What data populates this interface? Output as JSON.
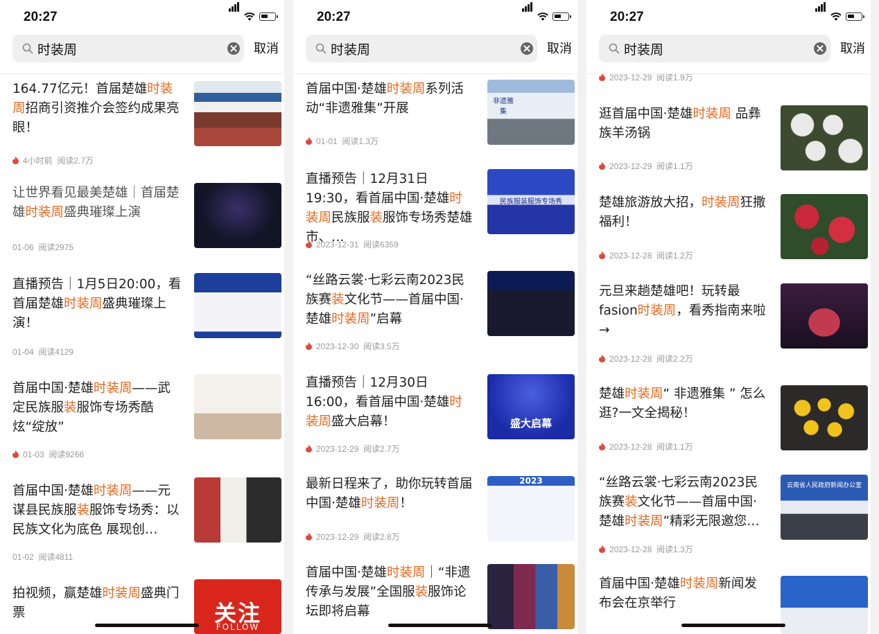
{
  "screens": [
    {
      "status": {
        "time": "20:27"
      },
      "search": {
        "value": "时装周",
        "cancel": "取消"
      },
      "items": [
        {
          "title_parts": [
            {
              "t": "164.77亿元！首届楚雄"
            },
            {
              "t": "时装周",
              "hl": true
            },
            {
              "t": "招商引资推介会签约成果亮眼！"
            }
          ],
          "meta": "4小时前  阅读2.7万",
          "hot": true,
          "thumb": "conference-photo"
        },
        {
          "title_parts": [
            {
              "t": "让世界看见最美楚雄｜首届楚雄"
            },
            {
              "t": "时装周",
              "hl": true
            },
            {
              "t": "盛典璀璨上演"
            }
          ],
          "meta": "01-06  阅读2975",
          "hot": false,
          "dim": true,
          "thumb": "stage-photo"
        },
        {
          "title_parts": [
            {
              "t": "直播预告｜1月5日20:00，看首届楚雄"
            },
            {
              "t": "时装周",
              "hl": true
            },
            {
              "t": "盛典璀璨上演！"
            }
          ],
          "meta": "01-04  阅读4129",
          "hot": false,
          "thumb": "poster-blue"
        },
        {
          "title_parts": [
            {
              "t": "首届中国·楚雄"
            },
            {
              "t": "时装周",
              "hl": true
            },
            {
              "t": "——武定民族服"
            },
            {
              "t": "装",
              "hl": true
            },
            {
              "t": "服饰专场秀酷炫“绽放”"
            }
          ],
          "meta": "01-03  阅读9266",
          "hot": true,
          "thumb": "runway-photo"
        },
        {
          "title_parts": [
            {
              "t": "首届中国·楚雄"
            },
            {
              "t": "时装周",
              "hl": true
            },
            {
              "t": "——元谋县民族服"
            },
            {
              "t": "装",
              "hl": true
            },
            {
              "t": "服饰专场秀：以民族文化为底色 展现创…"
            }
          ],
          "meta": "01-02  阅读4811",
          "hot": false,
          "thumb": "model-photo"
        },
        {
          "title_parts": [
            {
              "t": "拍视频，赢楚雄"
            },
            {
              "t": "时装周",
              "hl": true
            },
            {
              "t": "盛典门票"
            }
          ],
          "meta": "",
          "hot": false,
          "thumb": "follow-banner",
          "thumb_text": "关注",
          "thumb_sub": "FOLLOW"
        }
      ]
    },
    {
      "status": {
        "time": "20:27"
      },
      "search": {
        "value": "时装周",
        "cancel": "取消"
      },
      "items": [
        {
          "title_parts": [
            {
              "t": "首届中国·楚雄"
            },
            {
              "t": "时装周",
              "hl": true
            },
            {
              "t": "系列活动“非遗雅集”开展"
            }
          ],
          "meta": "01-01  阅读1.3万",
          "hot": true,
          "thumb": "tent-photo",
          "thumb_text": "非遗雅集"
        },
        {
          "title_parts": [
            {
              "t": "直播预告｜12月31日19:30，看首届中国·楚雄"
            },
            {
              "t": "时装周",
              "hl": true
            },
            {
              "t": "民族服"
            },
            {
              "t": "装",
              "hl": true
            },
            {
              "t": "服饰专场秀楚雄市、…"
            }
          ],
          "meta": "2023-12-31  阅读6359",
          "hot": true,
          "thumb": "poster-qr",
          "thumb_text": "民族服装服饰专场秀"
        },
        {
          "title_parts": [
            {
              "t": "“丝路云裳·七彩云南2023民族赛"
            },
            {
              "t": "装",
              "hl": true
            },
            {
              "t": "文化节——首届中国·楚雄"
            },
            {
              "t": "时装周",
              "hl": true
            },
            {
              "t": "”启幕"
            }
          ],
          "meta": "2023-12-30  阅读3.5万",
          "hot": true,
          "thumb": "runway-night"
        },
        {
          "title_parts": [
            {
              "t": "直播预告｜12月30日16:00，看首届中国·楚雄"
            },
            {
              "t": "时装周",
              "hl": true
            },
            {
              "t": "盛大启幕！"
            }
          ],
          "meta": "2023-12-29  阅读2.7万",
          "hot": true,
          "thumb": "poster-opening",
          "thumb_text": "盛大启幕"
        },
        {
          "title_parts": [
            {
              "t": "最新日程来了，助你玩转首届中国·楚雄"
            },
            {
              "t": "时装周",
              "hl": true
            },
            {
              "t": "！"
            }
          ],
          "meta": "2023-12-29  阅读2.8万",
          "hot": true,
          "thumb": "schedule-table",
          "thumb_text": "2023"
        },
        {
          "title_parts": [
            {
              "t": "首届中国·楚雄"
            },
            {
              "t": "时装周",
              "hl": true
            },
            {
              "t": "｜“非遗传承与发展”全国服"
            },
            {
              "t": "装",
              "hl": true
            },
            {
              "t": "服饰论坛即将启幕"
            }
          ],
          "meta": "",
          "hot": false,
          "thumb": "embroidery-photo"
        }
      ]
    },
    {
      "status": {
        "time": "20:27"
      },
      "search": {
        "value": "时装周",
        "cancel": "取消"
      },
      "items": [
        {
          "title_parts": [],
          "meta": "2023-12-29  阅读1.9万",
          "hot": true,
          "thumb": ""
        },
        {
          "title_parts": [
            {
              "t": "逛首届中国·楚雄"
            },
            {
              "t": "时装周",
              "hl": true
            },
            {
              "t": " 品彝族羊汤锅"
            }
          ],
          "meta": "2023-12-29  阅读1.1万",
          "hot": true,
          "thumb": "food-bowls"
        },
        {
          "title_parts": [
            {
              "t": "楚雄旅游放大招，"
            },
            {
              "t": "时装周",
              "hl": true
            },
            {
              "t": "狂撒福利！"
            }
          ],
          "meta": "2023-12-28  阅读1.2万",
          "hot": true,
          "thumb": "flowers"
        },
        {
          "title_parts": [
            {
              "t": "元旦来趟楚雄吧！玩转最fasion"
            },
            {
              "t": "时装周",
              "hl": true
            },
            {
              "t": "，看秀指南来啦→"
            }
          ],
          "meta": "2023-12-28  阅读2.2万",
          "hot": true,
          "thumb": "costume-photo"
        },
        {
          "title_parts": [
            {
              "t": "楚雄"
            },
            {
              "t": "时装周",
              "hl": true
            },
            {
              "t": "“ 非遗雅集 ” 怎么逛?一文全揭秘！"
            }
          ],
          "meta": "2023-12-28  阅读1.1万",
          "hot": true,
          "thumb": "yellow-cakes"
        },
        {
          "title_parts": [
            {
              "t": "“丝路云裳·七彩云南2023民族赛"
            },
            {
              "t": "装",
              "hl": true
            },
            {
              "t": "文化节——首届中国·楚雄"
            },
            {
              "t": "时装周",
              "hl": true
            },
            {
              "t": "”精彩无限邀您…"
            }
          ],
          "meta": "2023-12-28  阅读1.3万",
          "hot": true,
          "thumb": "press-room",
          "thumb_text": "云南省人民政府新闻办公室"
        },
        {
          "title_parts": [
            {
              "t": "首届中国·楚雄"
            },
            {
              "t": "时装周",
              "hl": true
            },
            {
              "t": "新闻发布会在京举行"
            }
          ],
          "meta": "",
          "hot": false,
          "thumb": "press-blue"
        }
      ]
    }
  ],
  "colors": {
    "highlight": "#e8681f",
    "meta": "#999999",
    "flame": "#e0483d",
    "text": "#222222"
  }
}
